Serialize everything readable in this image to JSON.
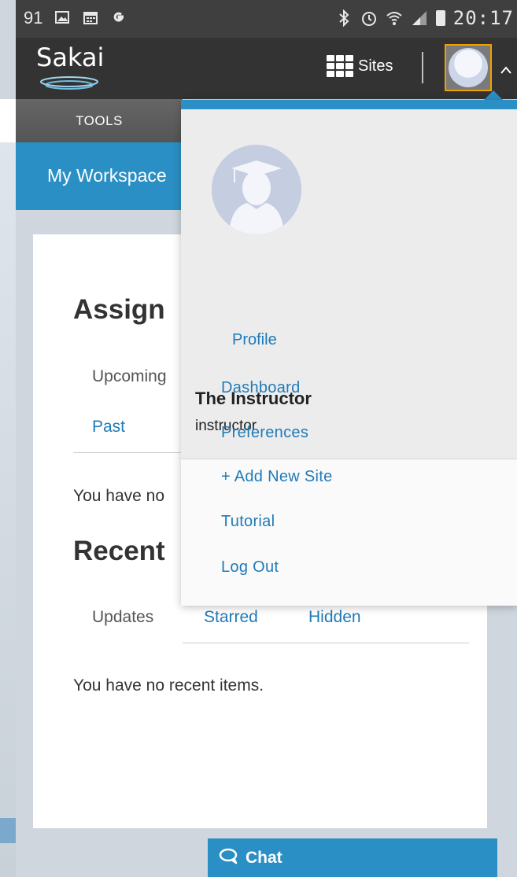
{
  "statusbar": {
    "left_text": "91",
    "left_icons": [
      "image-icon",
      "calendar-icon",
      "google-icon"
    ],
    "right_icons": [
      "bluetooth-icon",
      "alarm-icon",
      "wifi-icon",
      "signal-icon",
      "battery-icon"
    ],
    "time": "20:17"
  },
  "header": {
    "logo_text": "Sakai",
    "sites_label": "Sites",
    "tools_label": "TOOLS"
  },
  "sitenav": {
    "title": "My Workspace"
  },
  "main": {
    "assignments_heading": "Assign",
    "assignment_tabs": [
      "Upcoming",
      "Past"
    ],
    "assignments_empty": "You have no",
    "recent_heading": "Recent",
    "recent_tabs": [
      "Updates",
      "Starred",
      "Hidden"
    ],
    "recent_empty": "You have no recent items."
  },
  "chat": {
    "label": "Chat"
  },
  "dropdown": {
    "profile_label": "Profile",
    "user_name": "The Instructor",
    "user_id": "instructor",
    "menu": [
      "Dashboard",
      "Preferences",
      "+ Add New Site",
      "Tutorial",
      "Log Out"
    ]
  },
  "colors": {
    "brand_blue": "#2a8fc5",
    "link_blue": "#1f7ab8",
    "nav_dark": "#333333",
    "avatar_highlight": "#f0a000"
  }
}
